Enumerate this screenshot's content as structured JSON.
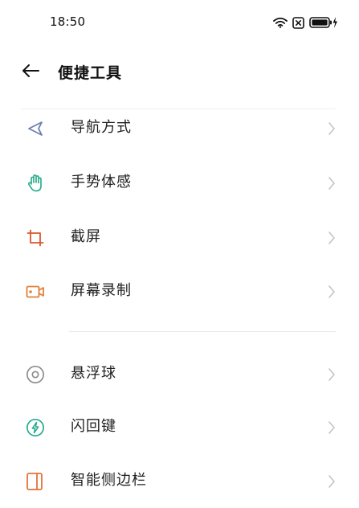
{
  "status_bar": {
    "time": "18:50"
  },
  "header": {
    "title": "便捷工具"
  },
  "groups": [
    {
      "items": [
        {
          "label": "导航方式",
          "icon": "navigation-arrow-icon",
          "color": "#6d7fb3"
        },
        {
          "label": "手势体感",
          "icon": "hand-gesture-icon",
          "color": "#2fae8f"
        },
        {
          "label": "截屏",
          "icon": "crop-screenshot-icon",
          "color": "#d9572f"
        },
        {
          "label": "屏幕录制",
          "icon": "screen-record-icon",
          "color": "#e0803a"
        }
      ]
    },
    {
      "items": [
        {
          "label": "悬浮球",
          "icon": "floating-ball-icon",
          "color": "#8a8a8a"
        },
        {
          "label": "闪回键",
          "icon": "flash-back-key-icon",
          "color": "#23a88e"
        },
        {
          "label": "智能侧边栏",
          "icon": "smart-sidebar-icon",
          "color": "#e2733a"
        }
      ]
    }
  ]
}
